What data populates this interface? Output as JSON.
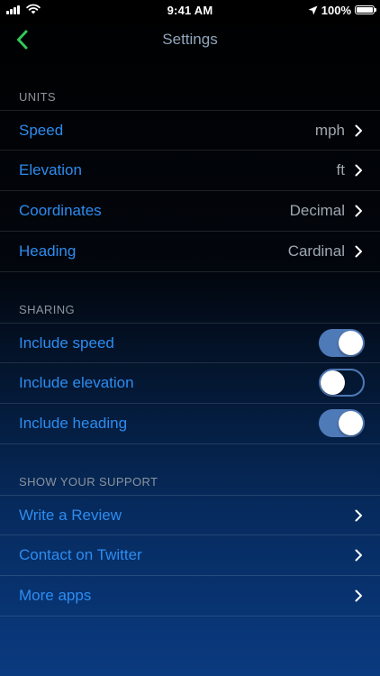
{
  "status_bar": {
    "time": "9:41 AM",
    "battery": "100%"
  },
  "nav": {
    "title": "Settings",
    "back_icon": "chevron-left-icon"
  },
  "colors": {
    "accent": "#2d8cf0",
    "back": "#34c759",
    "toggle_on": "#4f7ab8",
    "section_header": "#8b949c"
  },
  "units": {
    "header": "UNITS",
    "items": [
      {
        "label": "Speed",
        "value": "mph"
      },
      {
        "label": "Elevation",
        "value": "ft"
      },
      {
        "label": "Coordinates",
        "value": "Decimal"
      },
      {
        "label": "Heading",
        "value": "Cardinal"
      }
    ]
  },
  "sharing": {
    "header": "SHARING",
    "items": [
      {
        "label": "Include speed",
        "on": true
      },
      {
        "label": "Include elevation",
        "on": false
      },
      {
        "label": "Include heading",
        "on": true
      }
    ]
  },
  "support": {
    "header": "SHOW YOUR SUPPORT",
    "items": [
      {
        "label": "Write a Review"
      },
      {
        "label": "Contact on Twitter"
      },
      {
        "label": "More apps"
      }
    ]
  }
}
